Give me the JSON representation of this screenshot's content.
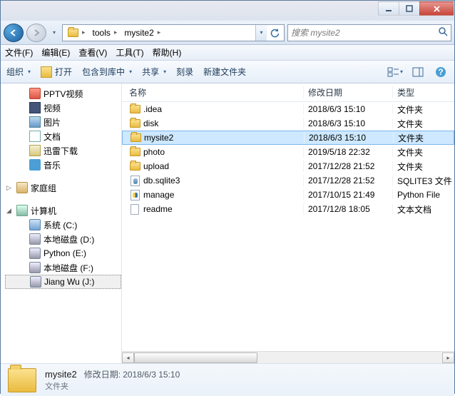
{
  "titlebar": {},
  "nav": {
    "breadcrumb": [
      {
        "label": "tools"
      },
      {
        "label": "mysite2"
      }
    ],
    "search_placeholder": "搜索 mysite2"
  },
  "menu": {
    "file": "文件(F)",
    "edit": "编辑(E)",
    "view": "查看(V)",
    "tools": "工具(T)",
    "help": "帮助(H)"
  },
  "toolbar": {
    "organize": "组织",
    "open": "打开",
    "include": "包含到库中",
    "share": "共享",
    "burn": "刻录",
    "newfolder": "新建文件夹"
  },
  "sidebar": {
    "items": [
      {
        "icon": "pptv",
        "label": "PPTV视频",
        "indent": 1
      },
      {
        "icon": "vid",
        "label": "视频",
        "indent": 1
      },
      {
        "icon": "pic",
        "label": "图片",
        "indent": 1
      },
      {
        "icon": "docs",
        "label": "文档",
        "indent": 1
      },
      {
        "icon": "thunder",
        "label": "迅雷下载",
        "indent": 1
      },
      {
        "icon": "music",
        "label": "音乐",
        "indent": 1
      },
      {
        "gap": true
      },
      {
        "icon": "home",
        "label": "家庭组",
        "indent": 0,
        "expand": "▷"
      },
      {
        "gap": true
      },
      {
        "icon": "pc",
        "label": "计算机",
        "indent": 0,
        "expand": "◢"
      },
      {
        "icon": "sys",
        "label": "系统 (C:)",
        "indent": 1
      },
      {
        "icon": "disk",
        "label": "本地磁盘 (D:)",
        "indent": 1
      },
      {
        "icon": "disk",
        "label": "Python (E:)",
        "indent": 1
      },
      {
        "icon": "disk",
        "label": "本地磁盘 (F:)",
        "indent": 1
      },
      {
        "icon": "disk",
        "label": "Jiang Wu (J:)",
        "indent": 1,
        "selected": true
      }
    ]
  },
  "columns": {
    "name": "名称",
    "date": "修改日期",
    "type": "类型"
  },
  "files": [
    {
      "icon": "folder",
      "name": ".idea",
      "date": "2018/6/3 15:10",
      "type": "文件夹"
    },
    {
      "icon": "folder",
      "name": "disk",
      "date": "2018/6/3 15:10",
      "type": "文件夹"
    },
    {
      "icon": "folder",
      "name": "mysite2",
      "date": "2018/6/3 15:10",
      "type": "文件夹",
      "selected": true
    },
    {
      "icon": "folder",
      "name": "photo",
      "date": "2019/5/18 22:32",
      "type": "文件夹"
    },
    {
      "icon": "folder",
      "name": "upload",
      "date": "2017/12/28 21:52",
      "type": "文件夹"
    },
    {
      "icon": "db",
      "name": "db.sqlite3",
      "date": "2017/12/28 21:52",
      "type": "SQLITE3 文件"
    },
    {
      "icon": "py",
      "name": "manage",
      "date": "2017/10/15 21:49",
      "type": "Python File"
    },
    {
      "icon": "file",
      "name": "readme",
      "date": "2017/12/8 18:05",
      "type": "文本文档"
    }
  ],
  "details": {
    "name": "mysite2",
    "date_label": "修改日期:",
    "date": "2018/6/3 15:10",
    "type": "文件夹"
  }
}
